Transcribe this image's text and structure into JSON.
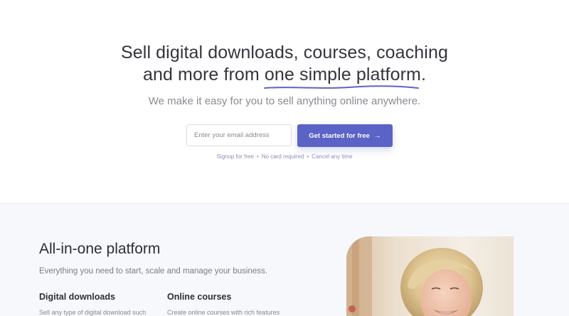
{
  "hero": {
    "headline_line1": "Sell digital downloads, courses, coaching",
    "headline_line2_prefix": "and more from ",
    "headline_highlight": "one simple platform",
    "headline_suffix": ".",
    "subheadline": "We make it easy for you to sell anything online anywhere.",
    "email_placeholder": "Enter your email address",
    "cta_label": "Get started for free",
    "cta_arrow": "→",
    "fineprint": [
      "Signup for free",
      "No card required",
      "Cancel any time"
    ],
    "fineprint_separator": "•"
  },
  "features": {
    "title": "All-in-one platform",
    "subtitle": "Everything you need to start, scale and manage your business.",
    "columns": [
      {
        "title": "Digital downloads",
        "description": "Sell any type of digital download such"
      },
      {
        "title": "Online courses",
        "description": "Create online courses with rich features"
      }
    ]
  },
  "colors": {
    "accent": "#5b63c6",
    "headline": "#34343c",
    "muted": "#8a8a92",
    "section_bg": "#f6f8fb"
  }
}
